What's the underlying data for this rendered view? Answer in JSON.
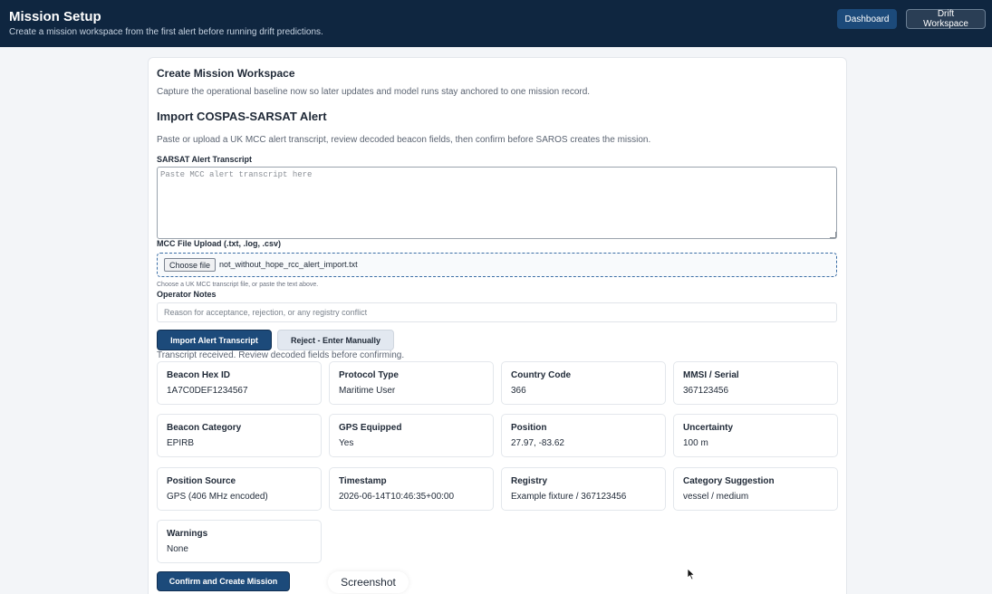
{
  "header": {
    "title": "Mission Setup",
    "subtitle": "Create a mission workspace from the first alert before running drift predictions.",
    "nav": {
      "dashboard": "Dashboard",
      "drift": "Drift Workspace"
    }
  },
  "workspace": {
    "heading": "Create Mission Workspace",
    "description": "Capture the operational baseline now so later updates and model runs stay anchored to one mission record."
  },
  "import": {
    "heading": "Import COSPAS-SARSAT Alert",
    "description": "Paste or upload a UK MCC alert transcript, review decoded beacon fields, then confirm before SAROS creates the mission.",
    "transcript_label": "SARSAT Alert Transcript",
    "transcript_placeholder": "Paste MCC alert transcript here",
    "file_label": "MCC File Upload (.txt, .log, .csv)",
    "choose_file": "Choose file",
    "file_name": "not_without_hope_rcc_alert_import.txt",
    "file_hint": "Choose a UK MCC transcript file, or paste the text above.",
    "notes_label": "Operator Notes",
    "notes_placeholder": "Reason for acceptance, rejection, or any registry conflict",
    "import_button": "Import Alert Transcript",
    "reject_button": "Reject - Enter Manually",
    "status": "Transcript received. Review decoded fields before confirming."
  },
  "fields": [
    {
      "label": "Beacon Hex ID",
      "value": "1A7C0DEF1234567"
    },
    {
      "label": "Protocol Type",
      "value": "Maritime User"
    },
    {
      "label": "Country Code",
      "value": "366"
    },
    {
      "label": "MMSI / Serial",
      "value": "367123456"
    },
    {
      "label": "Beacon Category",
      "value": "EPIRB"
    },
    {
      "label": "GPS Equipped",
      "value": "Yes"
    },
    {
      "label": "Position",
      "value": "27.97, -83.62"
    },
    {
      "label": "Uncertainty",
      "value": "100 m"
    },
    {
      "label": "Position Source",
      "value": "GPS (406 MHz encoded)"
    },
    {
      "label": "Timestamp",
      "value": "2026-06-14T10:46:35+00:00"
    },
    {
      "label": "Registry",
      "value": "Example fixture / 367123456"
    },
    {
      "label": "Category Suggestion",
      "value": "vessel / medium"
    },
    {
      "label": "Warnings",
      "value": "None"
    }
  ],
  "confirm_button": "Confirm and Create Mission",
  "tooltip": "Screenshot",
  "colors": {
    "header_bg": "#0f2640",
    "primary": "#1c4a7a",
    "secondary": "#e2e8f0"
  }
}
